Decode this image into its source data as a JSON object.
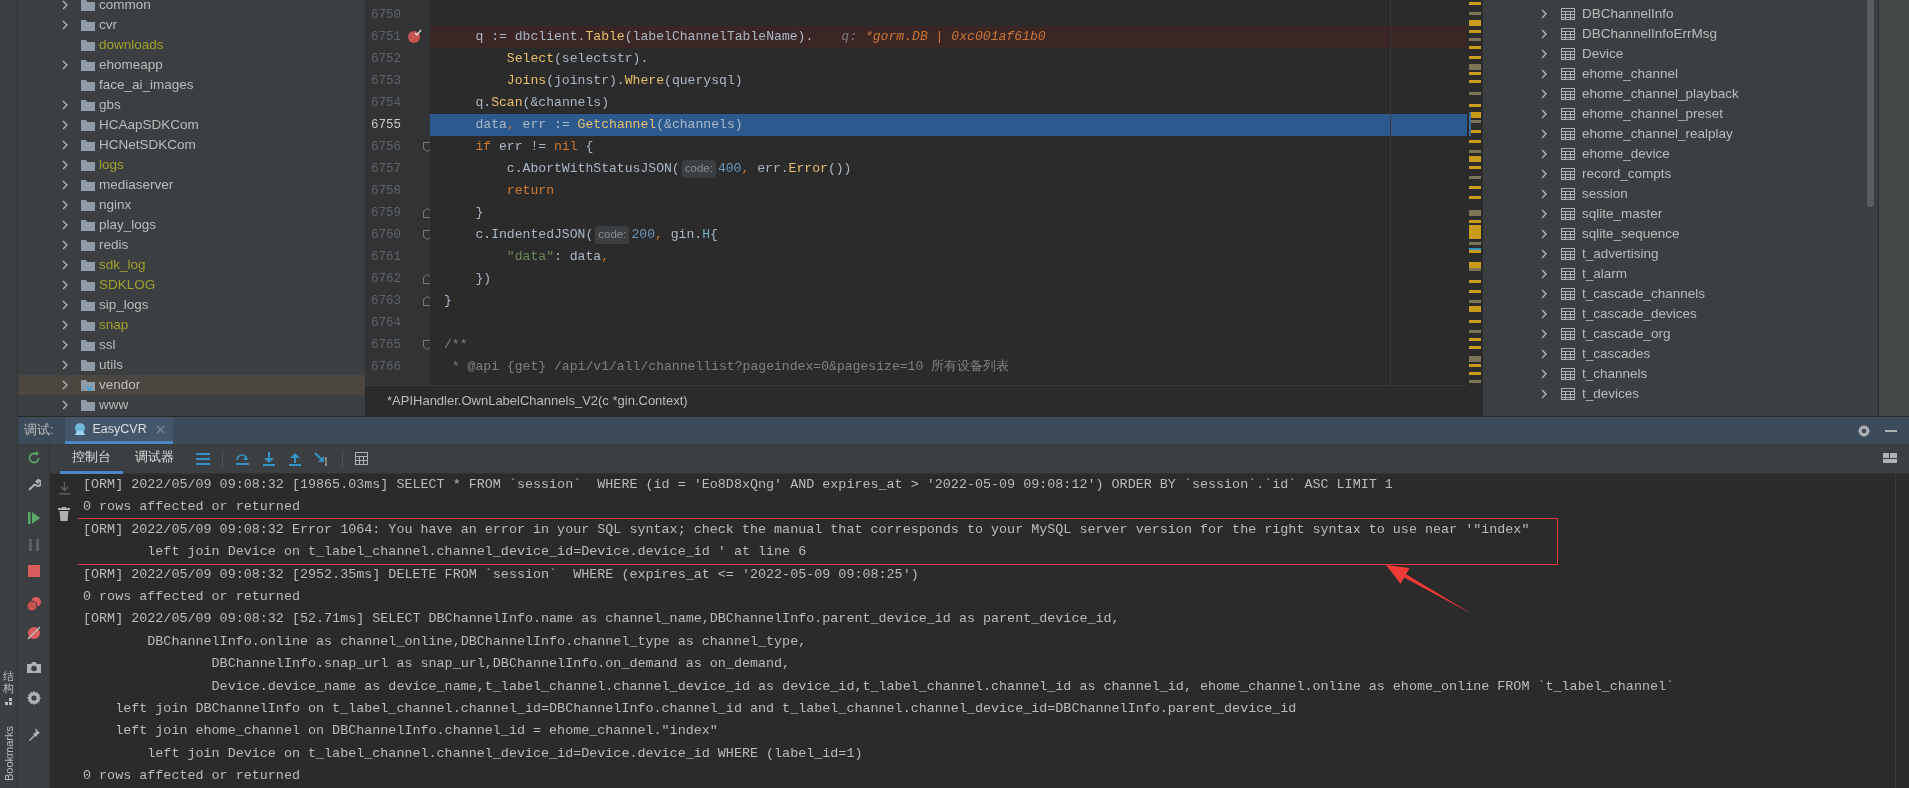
{
  "file_tree": {
    "items": [
      {
        "label": "common",
        "expandable": true,
        "excluded": false,
        "selected": false
      },
      {
        "label": "cvr",
        "expandable": true,
        "excluded": false,
        "selected": false
      },
      {
        "label": "downloads",
        "expandable": false,
        "excluded": true,
        "selected": false
      },
      {
        "label": "ehomeapp",
        "expandable": true,
        "excluded": false,
        "selected": false
      },
      {
        "label": "face_ai_images",
        "expandable": false,
        "excluded": false,
        "selected": false
      },
      {
        "label": "gbs",
        "expandable": true,
        "excluded": false,
        "selected": false
      },
      {
        "label": "HCAapSDKCom",
        "expandable": true,
        "excluded": false,
        "selected": false
      },
      {
        "label": "HCNetSDKCom",
        "expandable": true,
        "excluded": false,
        "selected": false
      },
      {
        "label": "logs",
        "expandable": true,
        "excluded": true,
        "selected": false
      },
      {
        "label": "mediaserver",
        "expandable": true,
        "excluded": false,
        "selected": false
      },
      {
        "label": "nginx",
        "expandable": true,
        "excluded": false,
        "selected": false
      },
      {
        "label": "play_logs",
        "expandable": true,
        "excluded": false,
        "selected": false
      },
      {
        "label": "redis",
        "expandable": true,
        "excluded": false,
        "selected": false
      },
      {
        "label": "sdk_log",
        "expandable": true,
        "excluded": true,
        "selected": false
      },
      {
        "label": "SDKLOG",
        "expandable": true,
        "excluded": true,
        "selected": false
      },
      {
        "label": "sip_logs",
        "expandable": true,
        "excluded": false,
        "selected": false
      },
      {
        "label": "snap",
        "expandable": true,
        "excluded": true,
        "selected": false
      },
      {
        "label": "ssl",
        "expandable": true,
        "excluded": false,
        "selected": false
      },
      {
        "label": "utils",
        "expandable": true,
        "excluded": false,
        "selected": false
      },
      {
        "label": "vendor",
        "expandable": true,
        "excluded": false,
        "selected": true
      },
      {
        "label": "www",
        "expandable": true,
        "excluded": false,
        "selected": false
      }
    ]
  },
  "editor": {
    "lines": [
      {
        "number": "6750",
        "breakpoint": false,
        "selected": false,
        "fold_start": false,
        "fold_end": false
      },
      {
        "number": "6751",
        "breakpoint": true,
        "selected": false,
        "fold_start": false,
        "fold_end": false,
        "tokens": [
          {
            "text": "    q := dbclient.",
            "kind": "plain"
          },
          {
            "text": "Table",
            "kind": "call"
          },
          {
            "text": "(labelChannelTableName).",
            "kind": "plain"
          }
        ],
        "inline_value": {
          "name": "q:",
          "value": "*gorm.DB | 0xc001af61b0"
        }
      },
      {
        "number": "6752",
        "breakpoint": false,
        "selected": false,
        "fold_start": false,
        "fold_end": false,
        "tokens": [
          {
            "text": "        Select",
            "kind": "call"
          },
          {
            "text": "(selectstr).",
            "kind": "plain"
          }
        ]
      },
      {
        "number": "6753",
        "breakpoint": false,
        "selected": false,
        "fold_start": false,
        "fold_end": false,
        "tokens": [
          {
            "text": "        Joins",
            "kind": "call"
          },
          {
            "text": "(joinstr).",
            "kind": "plain"
          },
          {
            "text": "Where",
            "kind": "call"
          },
          {
            "text": "(querysql)",
            "kind": "plain"
          }
        ]
      },
      {
        "number": "6754",
        "breakpoint": false,
        "selected": false,
        "fold_start": false,
        "fold_end": false,
        "tokens": [
          {
            "text": "    q.",
            "kind": "plain"
          },
          {
            "text": "Scan",
            "kind": "call"
          },
          {
            "text": "(&channels)",
            "kind": "plain"
          }
        ]
      },
      {
        "number": "6755",
        "breakpoint": false,
        "selected": true,
        "fold_start": false,
        "fold_end": false,
        "tokens": [
          {
            "text": "    data",
            "kind": "plain"
          },
          {
            "text": ",",
            "kind": "op"
          },
          {
            "text": " err := ",
            "kind": "plain"
          },
          {
            "text": "Getchannel",
            "kind": "call"
          },
          {
            "text": "(&channels)",
            "kind": "plain"
          }
        ]
      },
      {
        "number": "6756",
        "breakpoint": false,
        "selected": false,
        "fold_start": true,
        "fold_end": false,
        "tokens": [
          {
            "text": "    if",
            "kind": "keyword"
          },
          {
            "text": " err != ",
            "kind": "plain"
          },
          {
            "text": "nil",
            "kind": "keyword"
          },
          {
            "text": " {",
            "kind": "plain"
          }
        ]
      },
      {
        "number": "6757",
        "breakpoint": false,
        "selected": false,
        "fold_start": false,
        "fold_end": false,
        "tokens": [
          {
            "text": "        c.AbortWithStatusJSON(",
            "kind": "plain"
          },
          {
            "text": "code:",
            "kind": "hint"
          },
          {
            "text": "400",
            "kind": "number"
          },
          {
            "text": ",",
            "kind": "op"
          },
          {
            "text": " err.",
            "kind": "plain"
          },
          {
            "text": "Error",
            "kind": "call"
          },
          {
            "text": "())",
            "kind": "plain"
          }
        ]
      },
      {
        "number": "6758",
        "breakpoint": false,
        "selected": false,
        "fold_start": false,
        "fold_end": false,
        "tokens": [
          {
            "text": "        return",
            "kind": "keyword"
          }
        ]
      },
      {
        "number": "6759",
        "breakpoint": false,
        "selected": false,
        "fold_start": false,
        "fold_end": true,
        "tokens": [
          {
            "text": "    }",
            "kind": "plain"
          }
        ]
      },
      {
        "number": "6760",
        "breakpoint": false,
        "selected": false,
        "fold_start": true,
        "fold_end": false,
        "tokens": [
          {
            "text": "    c.IndentedJSON(",
            "kind": "plain"
          },
          {
            "text": "code:",
            "kind": "hint"
          },
          {
            "text": "200",
            "kind": "number"
          },
          {
            "text": ",",
            "kind": "op"
          },
          {
            "text": " gin.",
            "kind": "plain"
          },
          {
            "text": "H",
            "kind": "type"
          },
          {
            "text": "{",
            "kind": "plain"
          }
        ]
      },
      {
        "number": "6761",
        "breakpoint": false,
        "selected": false,
        "fold_start": false,
        "fold_end": false,
        "tokens": [
          {
            "text": "        \"data\"",
            "kind": "string"
          },
          {
            "text": ": data",
            "kind": "plain"
          },
          {
            "text": ",",
            "kind": "op"
          }
        ]
      },
      {
        "number": "6762",
        "breakpoint": false,
        "selected": false,
        "fold_start": false,
        "fold_end": true,
        "tokens": [
          {
            "text": "    })",
            "kind": "plain"
          }
        ]
      },
      {
        "number": "6763",
        "breakpoint": false,
        "selected": false,
        "fold_start": false,
        "fold_end": true,
        "tokens": [
          {
            "text": "}",
            "kind": "plain"
          }
        ]
      },
      {
        "number": "6764",
        "breakpoint": false,
        "selected": false,
        "fold_start": false,
        "fold_end": false
      },
      {
        "number": "6765",
        "breakpoint": false,
        "selected": false,
        "fold_start": true,
        "fold_end": false,
        "tokens": [
          {
            "text": "/**",
            "kind": "comment"
          }
        ]
      },
      {
        "number": "6766",
        "breakpoint": false,
        "selected": false,
        "fold_start": false,
        "fold_end": false,
        "tokens": [
          {
            "text": " * @api {get} /api/v1/all/channellist?pageindex=0&pagesize=10 所有设备列表",
            "kind": "comment"
          }
        ]
      }
    ],
    "breadcrumb": "*APIHandler.OwnLabelChannels_V2(c *gin.Context)"
  },
  "database": {
    "tables": [
      {
        "label": "DBChannelInfo",
        "expanded": false
      },
      {
        "label": "DBChannelInfoErrMsg",
        "expanded": false
      },
      {
        "label": "Device",
        "expanded": false
      },
      {
        "label": "ehome_channel",
        "expanded": false
      },
      {
        "label": "ehome_channel_playback",
        "expanded": false
      },
      {
        "label": "ehome_channel_preset",
        "expanded": false
      },
      {
        "label": "ehome_channel_realplay",
        "expanded": false
      },
      {
        "label": "ehome_device",
        "expanded": false
      },
      {
        "label": "record_compts",
        "expanded": false
      },
      {
        "label": "session",
        "expanded": false
      },
      {
        "label": "sqlite_master",
        "expanded": false
      },
      {
        "label": "sqlite_sequence",
        "expanded": false
      },
      {
        "label": "t_advertising",
        "expanded": false
      },
      {
        "label": "t_alarm",
        "expanded": false
      },
      {
        "label": "t_cascade_channels",
        "expanded": false
      },
      {
        "label": "t_cascade_devices",
        "expanded": false
      },
      {
        "label": "t_cascade_org",
        "expanded": false
      },
      {
        "label": "t_cascades",
        "expanded": false
      },
      {
        "label": "t_channels",
        "expanded": false
      },
      {
        "label": "t_devices",
        "expanded": false
      }
    ]
  },
  "debug_panel": {
    "label": "调试:",
    "tabs": [
      {
        "label": "EasyCVR",
        "selected": true
      }
    ],
    "subtabs": [
      {
        "label": "控制台",
        "selected": true
      },
      {
        "label": "调试器",
        "selected": false
      }
    ]
  },
  "console": {
    "entries": [
      {
        "boxed": false,
        "lines": [
          "[ORM] 2022/05/09 09:08:32 [19865.03ms] SELECT * FROM `session`  WHERE (id = 'Eo8D8xQng' AND expires_at > '2022-05-09 09:08:12') ORDER BY `session`.`id` ASC LIMIT 1",
          "0 rows affected or returned"
        ]
      },
      {
        "boxed": true,
        "lines": [
          "[ORM] 2022/05/09 09:08:32 Error 1064: You have an error in your SQL syntax; check the manual that corresponds to your MySQL server version for the right syntax to use near '\"index\"",
          "        left join Device on t_label_channel.channel_device_id=Device.device_id ' at line 6"
        ]
      },
      {
        "boxed": false,
        "lines": [
          "[ORM] 2022/05/09 09:08:32 [2952.35ms] DELETE FROM `session`  WHERE (expires_at <= '2022-05-09 09:08:25')",
          "0 rows affected or returned",
          "[ORM] 2022/05/09 09:08:32 [52.71ms] SELECT DBChannelInfo.name as channel_name,DBChannelInfo.parent_device_id as parent_device_id,",
          "        DBChannelInfo.online as channel_online,DBChannelInfo.channel_type as channel_type,",
          "                DBChannelInfo.snap_url as snap_url,DBChannelInfo.on_demand as on_demand,",
          "                Device.device_name as device_name,t_label_channel.channel_device_id as device_id,t_label_channel.channel_id as channel_id, ehome_channel.online as ehome_online FROM `t_label_channel`",
          "    left join DBChannelInfo on t_label_channel.channel_id=DBChannelInfo.channel_id and t_label_channel.channel_device_id=DBChannelInfo.parent_device_id",
          "    left join ehome_channel on DBChannelInfo.channel_id = ehome_channel.\"index\"",
          "        left join Device on t_label_channel.channel_device_id=Device.device_id WHERE (label_id=1)",
          "0 rows affected or returned"
        ]
      }
    ]
  },
  "side_labels": [
    "结构",
    "Bookmarks"
  ]
}
